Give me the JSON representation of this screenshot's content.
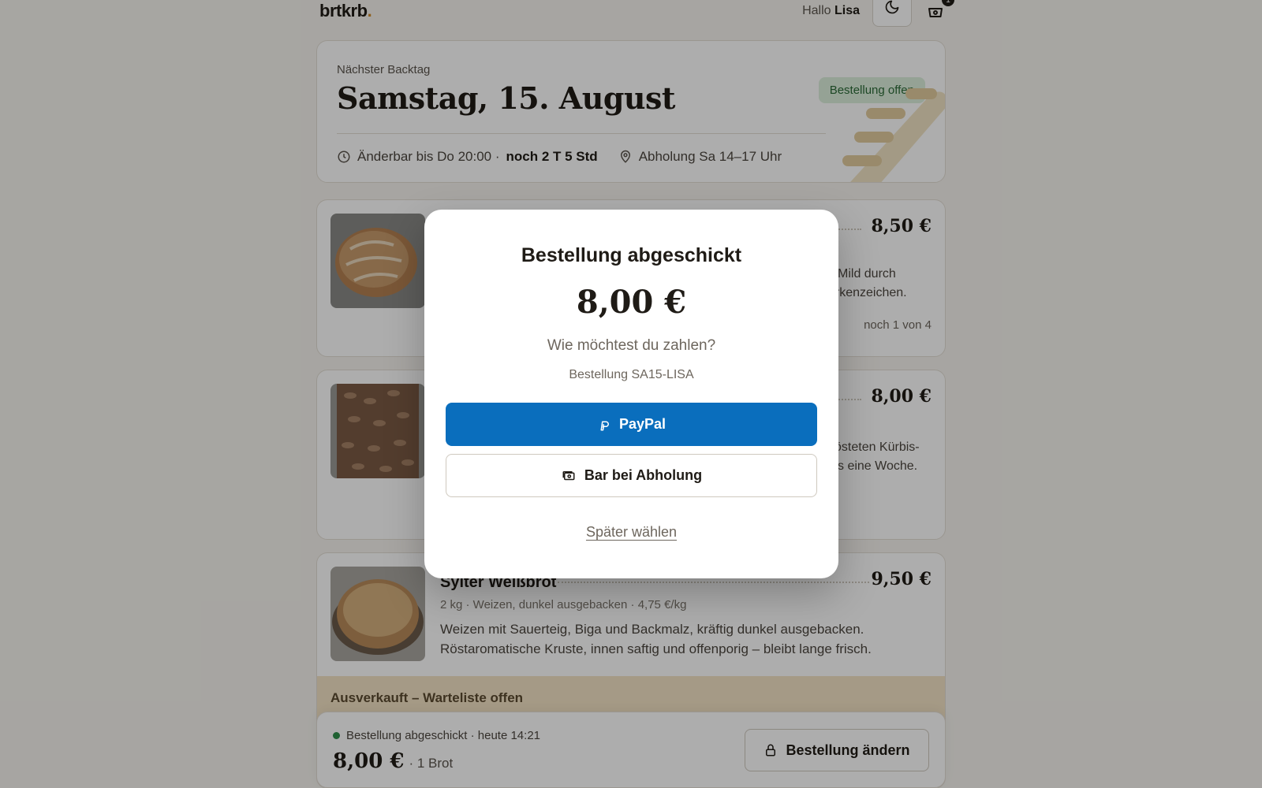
{
  "header": {
    "logo_text": "brtkrb",
    "logo_dot": ".",
    "greeting": "Hallo",
    "user_name": "Lisa",
    "cart_count": "1"
  },
  "bake_day": {
    "label": "Nächster Backtag",
    "date": "Samstag, 15. August",
    "status": "Bestellung offen",
    "editable_until": "Änderbar bis Do 20:00 ·",
    "time_left": "noch 2 T 5 Std",
    "pickup": "Abholung Sa 14–17 Uhr"
  },
  "products": [
    {
      "price": "8,50 €",
      "desc_line1": "Mild durch",
      "desc_line2": "arkenzeichen.",
      "stock": "noch 1 von 4"
    },
    {
      "price": "8,00 €",
      "desc_line1": "östeten Kürbis-",
      "desc_line2": "s eine Woche."
    },
    {
      "title": "Sylter Weißbrot",
      "price": "9,50 €",
      "subtitle": "2 kg · Weizen, dunkel ausgebacken · 4,75 €/kg",
      "description": "Weizen mit Sauerteig, Biga und Backmalz, kräftig dunkel ausgebacken. Röstaromatische Kruste, innen saftig und offenporig – bleibt lange frisch.",
      "soldout": "Ausverkauft – Warteliste offen"
    }
  ],
  "bottom_bar": {
    "status": "Bestellung abgeschickt · heute 14:21",
    "amount": "8,00 €",
    "count": "· 1 Brot",
    "button": "Bestellung ändern"
  },
  "modal": {
    "title": "Bestellung abgeschickt",
    "amount": "8,00 €",
    "question": "Wie möchtest du zahlen?",
    "order_ref": "Bestellung SA15-LISA",
    "paypal": "PayPal",
    "cash": "Bar bei Abholung",
    "later": "Später wählen"
  },
  "colors": {
    "paypal_blue": "#0a6ebd",
    "status_green": "#2f8f4a",
    "soldout_bg": "#f4e4c6",
    "accent_orange": "#d18b2c"
  }
}
